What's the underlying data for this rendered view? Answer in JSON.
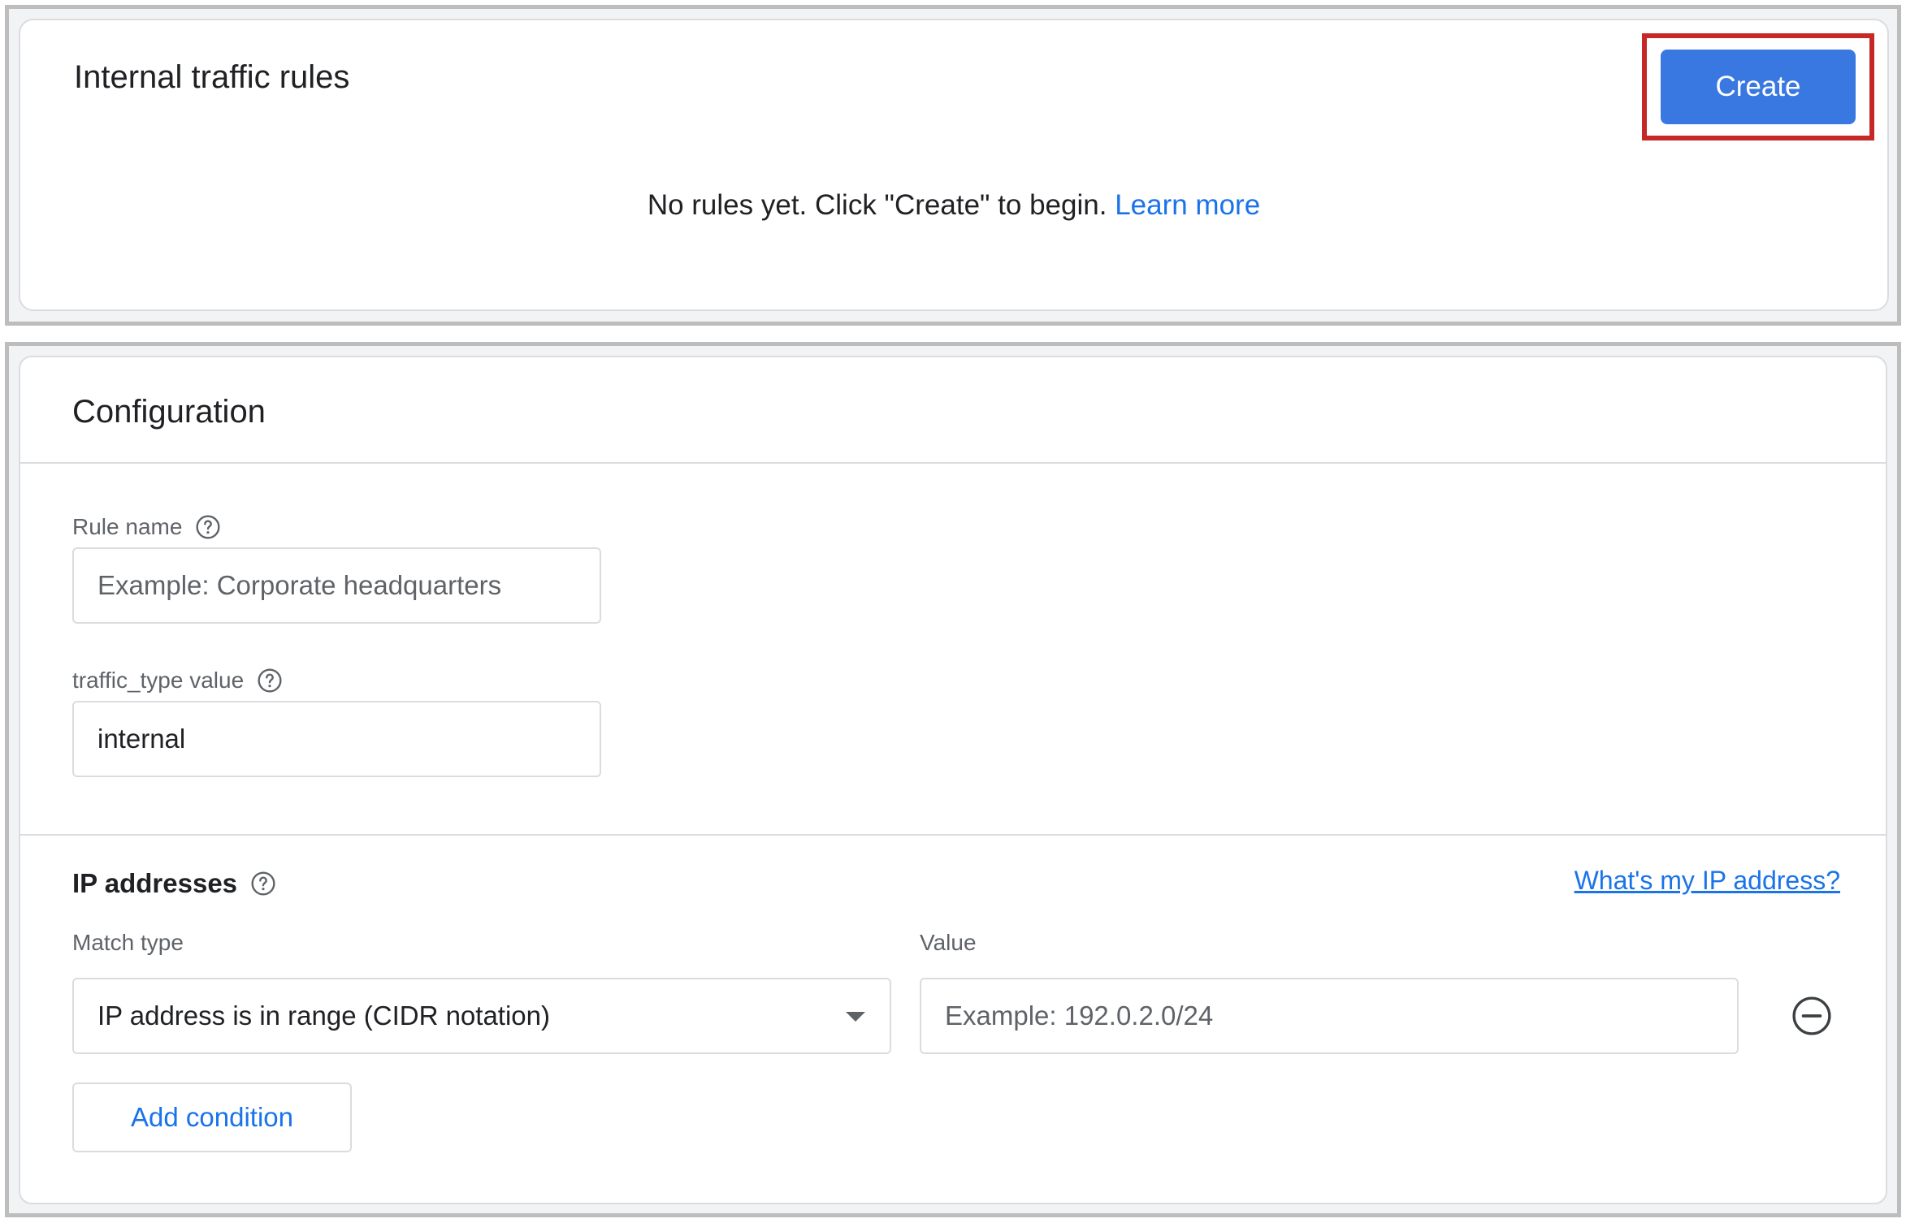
{
  "rules_panel": {
    "title": "Internal traffic rules",
    "create_label": "Create",
    "empty_text": "No rules yet. Click \"Create\" to begin.",
    "learn_more": "Learn more"
  },
  "config_panel": {
    "title": "Configuration",
    "rule_name": {
      "label": "Rule name",
      "placeholder": "Example: Corporate headquarters"
    },
    "traffic_type": {
      "label": "traffic_type value",
      "value": "internal"
    },
    "ip_section": {
      "title": "IP addresses",
      "whats_my_ip": "What's my IP address?",
      "match_type_label": "Match type",
      "match_type_value": "IP address is in range (CIDR notation)",
      "value_label": "Value",
      "value_placeholder": "Example: 192.0.2.0/24",
      "add_condition": "Add condition"
    }
  },
  "colors": {
    "accent": "#3a78e1",
    "link": "#1a73e8",
    "highlight": "#c62828"
  }
}
